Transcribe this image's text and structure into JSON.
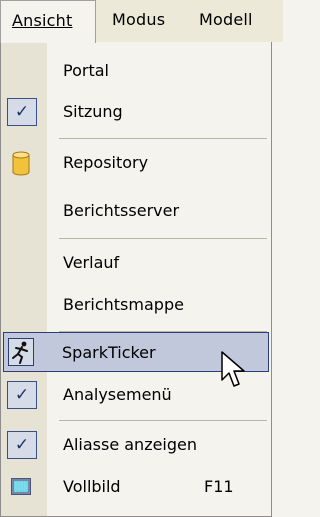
{
  "menubar": {
    "items": [
      {
        "label": "Ansicht",
        "active": true
      },
      {
        "label": "Modus",
        "active": false
      },
      {
        "label": "Modell",
        "active": false
      }
    ]
  },
  "menu": {
    "items": [
      {
        "label": "Portal",
        "checked": false
      },
      {
        "label": "Sitzung",
        "checked": true
      },
      {
        "label": "Repository",
        "icon": "database-icon"
      },
      {
        "label": "Berichtsserver"
      },
      {
        "label": "Verlauf"
      },
      {
        "label": "Berichtsmappe"
      },
      {
        "label": "SparkTicker",
        "icon": "runner-icon",
        "highlighted": true
      },
      {
        "label": "Analysemenü",
        "checked": true
      },
      {
        "label": "Aliasse anzeigen",
        "checked": true
      },
      {
        "label": "Vollbild",
        "icon": "fullscreen-icon",
        "shortcut": "F11"
      }
    ]
  },
  "colors": {
    "highlight": "#c1c8dc",
    "highlight_border": "#2b3f76",
    "database_icon": "#f2c23a"
  }
}
